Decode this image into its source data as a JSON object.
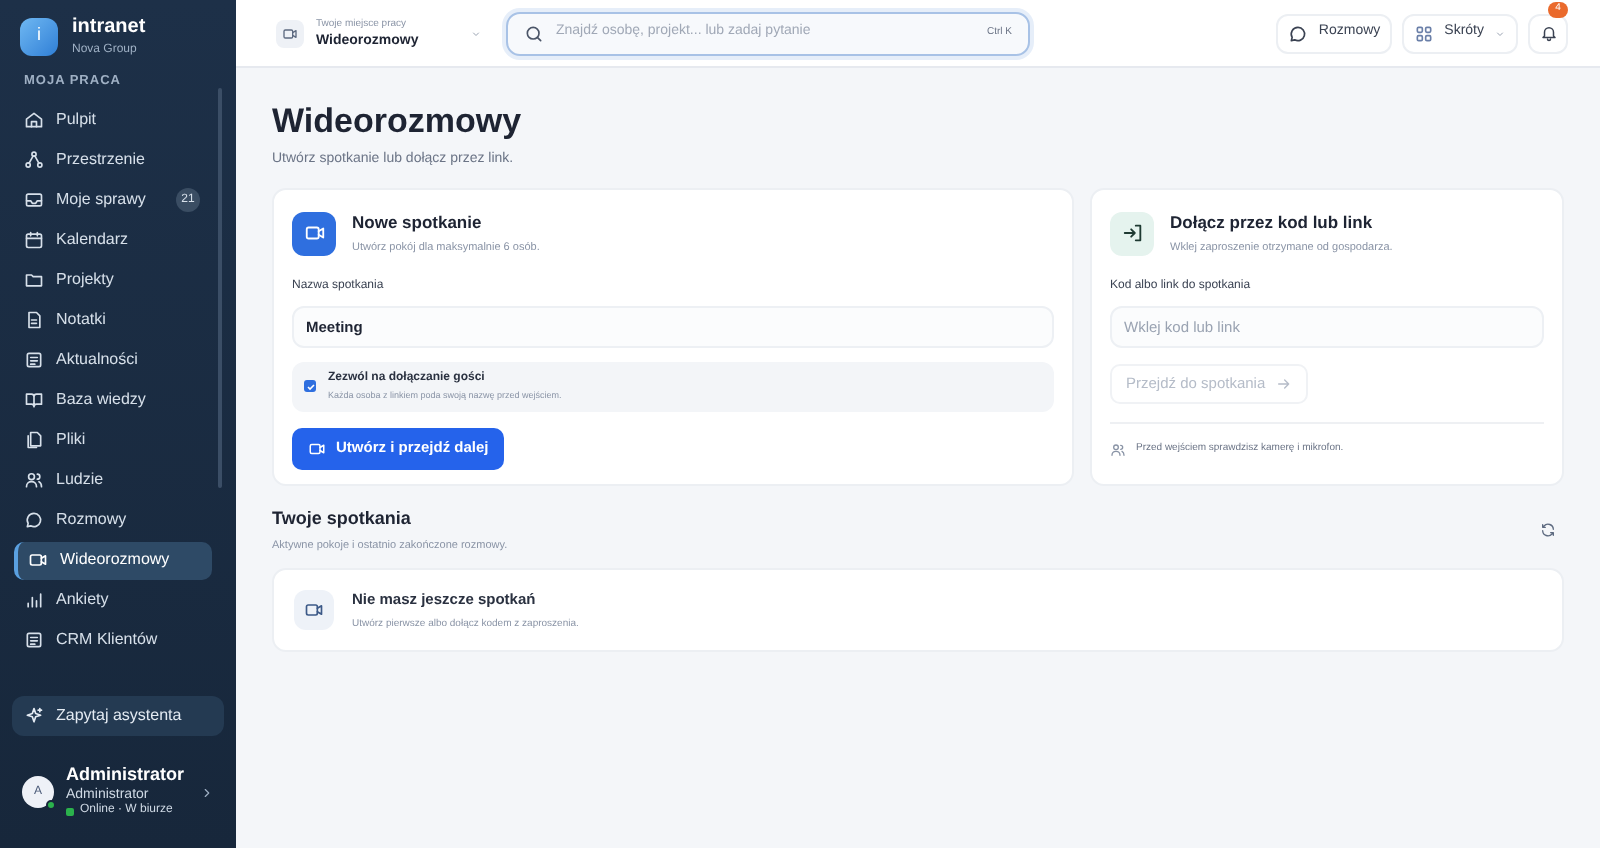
{
  "app": {
    "logo_letter": "i",
    "name": "intranet",
    "org": "Nova Group"
  },
  "sidebar": {
    "section": "MOJA PRACA",
    "items": [
      {
        "label": "Pulpit",
        "selected": false
      },
      {
        "label": "Przestrzenie",
        "selected": false
      },
      {
        "label": "Moje sprawy",
        "selected": false,
        "badge": "21"
      },
      {
        "label": "Kalendarz",
        "selected": false
      },
      {
        "label": "Projekty",
        "selected": false
      },
      {
        "label": "Notatki",
        "selected": false
      },
      {
        "label": "Aktualności",
        "selected": false
      },
      {
        "label": "Baza wiedzy",
        "selected": false
      },
      {
        "label": "Pliki",
        "selected": false
      },
      {
        "label": "Ludzie",
        "selected": false
      },
      {
        "label": "Rozmowy",
        "selected": false
      },
      {
        "label": "Wideorozmowy",
        "selected": true
      },
      {
        "label": "Ankiety",
        "selected": false
      },
      {
        "label": "CRM Klientów",
        "selected": false
      }
    ],
    "assistant": "Zapytaj asystenta",
    "user": {
      "initial": "A",
      "name": "Administrator",
      "role": "Administrator",
      "status": "Online · W biurze"
    }
  },
  "topbar": {
    "workspace_label": "Twoje miejsce pracy",
    "workspace": "Wideorozmowy",
    "search_placeholder": "Znajdź osobę, projekt... lub zadaj pytanie",
    "shortcut": "Ctrl K",
    "chat_button": "Rozmowy",
    "shortcuts_button": "Skróty",
    "notifications": "4"
  },
  "page": {
    "title": "Wideorozmowy",
    "subtitle": "Utwórz spotkanie lub dołącz przez link."
  },
  "new_meeting": {
    "title": "Nowe spotkanie",
    "subtitle": "Utwórz pokój dla maksymalnie 6 osób.",
    "field_label": "Nazwa spotkania",
    "field_value": "Meeting",
    "guests": {
      "label": "Zezwól na dołączanie gości",
      "hint": "Każda osoba z linkiem poda swoją nazwę przed wejściem.",
      "checked": true
    },
    "button": "Utwórz i przejdź dalej"
  },
  "join": {
    "title": "Dołącz przez kod lub link",
    "subtitle": "Wklej zaproszenie otrzymane od gospodarza.",
    "field_label": "Kod albo link do spotkania",
    "placeholder": "Wklej kod lub link",
    "button": "Przejdź do spotkania",
    "disabled": true,
    "note": "Przed wejściem sprawdzisz kamerę i mikrofon."
  },
  "meetings": {
    "title": "Twoje spotkania",
    "subtitle": "Aktywne pokoje i ostatnio zakończone rozmowy.",
    "empty_title": "Nie masz jeszcze spotkań",
    "empty_text": "Utwórz pierwsze albo dołącz kodem z zaproszenia."
  }
}
